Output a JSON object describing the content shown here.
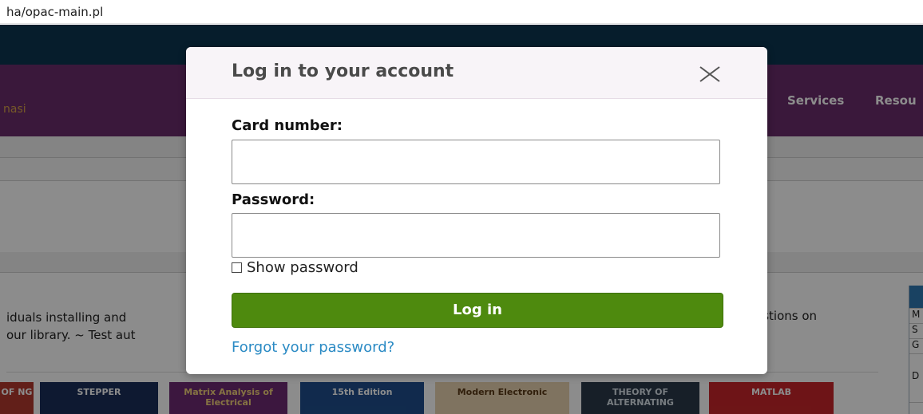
{
  "browser": {
    "url": "ha/opac-main.pl"
  },
  "background": {
    "nav_left": "nasi",
    "nav_items": [
      "Services",
      "Resou"
    ],
    "intro_line1": "iduals installing and",
    "intro_line2": "our library. ~ Test aut",
    "intro_right": "estions on",
    "side_cells": [
      "M",
      "S",
      "G",
      "D"
    ],
    "covers": [
      {
        "text": "OF NG",
        "bg": "#b23a2e",
        "fg": "#ffffff"
      },
      {
        "text": "STEPPER",
        "bg": "#1a2e5a",
        "fg": "#ffffff"
      },
      {
        "text": "Matrix Analysis of Electrical",
        "bg": "#6e2a74",
        "fg": "#f3d27a"
      },
      {
        "text": "15th Edition",
        "bg": "#1f4e8c",
        "fg": "#ffffff"
      },
      {
        "text": "Modern Electronic",
        "bg": "#e8d2b0",
        "fg": "#5a3a16"
      },
      {
        "text": "THEORY OF ALTERNATING",
        "bg": "#2a3a4a",
        "fg": "#d9e2ea"
      },
      {
        "text": "MATLAB",
        "bg": "#c8262a",
        "fg": "#ffffff"
      }
    ]
  },
  "modal": {
    "title": "Log in to your account",
    "card_label": "Card number:",
    "card_value": "",
    "password_label": "Password:",
    "password_value": "",
    "show_password_label": "Show password",
    "login_button": "Log in",
    "forgot_link": "Forgot your password?"
  },
  "colors": {
    "topbar": "#0c3550",
    "navbar": "#6b2d6c",
    "login_button": "#4e8a0e",
    "link": "#2a8ac4"
  }
}
